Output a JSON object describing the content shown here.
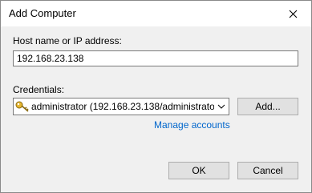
{
  "window": {
    "title": "Add Computer"
  },
  "host": {
    "label": "Host name or IP address:",
    "value": "192.168.23.138"
  },
  "credentials": {
    "label": "Credentials:",
    "selected": "administrator (192.168.23.138/administrator)",
    "add_label": "Add...",
    "manage_link": "Manage accounts"
  },
  "footer": {
    "ok_label": "OK",
    "cancel_label": "Cancel"
  },
  "icons": {
    "close": "close-icon",
    "key": "key-icon",
    "dropdown": "chevron-down-icon"
  }
}
